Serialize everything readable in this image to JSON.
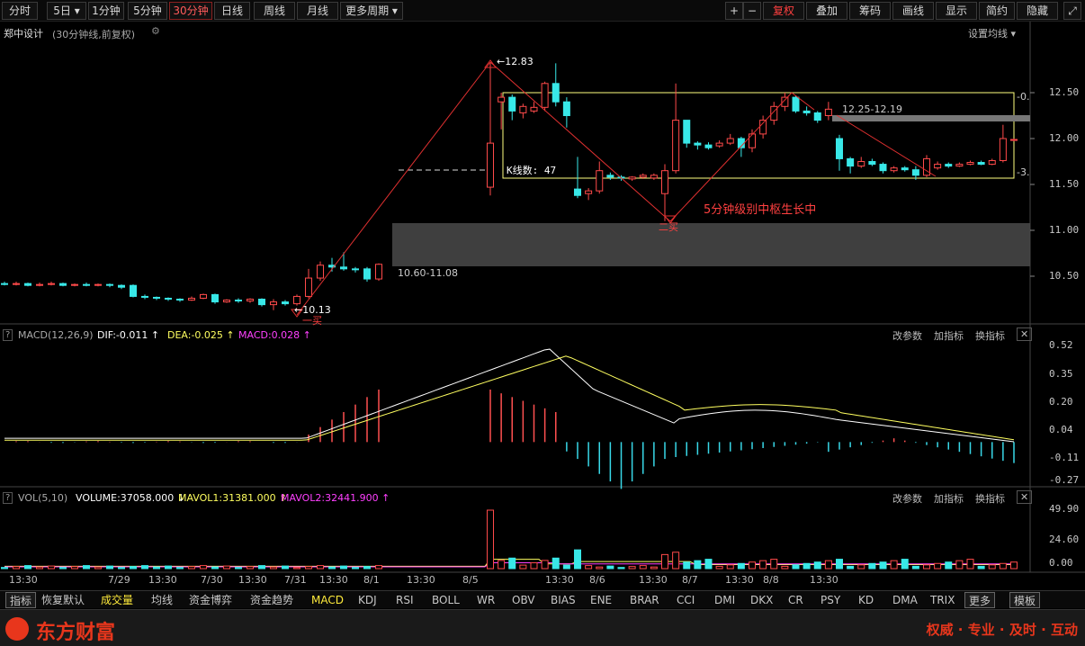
{
  "toolbar": {
    "left": [
      "分时",
      "5日",
      "1分钟",
      "5分钟",
      "30分钟",
      "日线",
      "周线",
      "月线",
      "更多周期"
    ],
    "right": [
      "+",
      "−",
      "复权",
      "叠加",
      "筹码",
      "画线",
      "显示",
      "简约",
      "隐藏"
    ],
    "five_day_arrow": "▾",
    "more_arrow": "▾"
  },
  "stock": {
    "name": "郑中设计",
    "desc": "(30分钟线,前复权)",
    "ma_setting": "设置均线"
  },
  "price_scale": [
    "12.50",
    "12.00",
    "11.50",
    "11.00",
    "10.50"
  ],
  "annotations": {
    "high": "←12.83",
    "low": "←10.13",
    "low_mark": "一买",
    "mid_low_mark": "二买",
    "zone_upper": "12.25-12.19",
    "zone_lower": "10.60-11.08",
    "kline_count": "K线数: 47",
    "pivot_text": "5分钟级别中枢生长中",
    "right_top_label": "-0.",
    "right_bottom_label": "-3."
  },
  "macd": {
    "title": "MACD(12,26,9)",
    "dif": "DIF:-0.011",
    "dea": "DEA:-0.025",
    "macd": "MACD:0.028",
    "scale": [
      "0.52",
      "0.35",
      "0.20",
      "0.04",
      "-0.11",
      "-0.27"
    ],
    "btns": [
      "改参数",
      "加指标",
      "换指标"
    ]
  },
  "vol": {
    "title": "VOL(5,10)",
    "volume": "VOLUME:37058.000",
    "mavol1": "MAVOL1:31381.000",
    "mavol2": "MAVOL2:32441.900",
    "scale": [
      "49.90",
      "24.60",
      "0.00"
    ],
    "btns": [
      "改参数",
      "加指标",
      "换指标"
    ]
  },
  "time_axis": [
    "13:30",
    "7/29",
    "13:30",
    "7/30",
    "13:30",
    "7/31",
    "13:30",
    "8/1",
    "13:30",
    "8/5",
    "13:30",
    "8/6",
    "13:30",
    "8/7",
    "13:30",
    "8/8",
    "13:30"
  ],
  "tabs": [
    "指标",
    "恢复默认",
    "成交量",
    "均线",
    "资金博弈",
    "资金趋势",
    "MACD",
    "KDJ",
    "RSI",
    "BOLL",
    "WR",
    "OBV",
    "BIAS",
    "ENE",
    "BRAR",
    "CCI",
    "DMI",
    "DKX",
    "CR",
    "PSY",
    "KD",
    "DMA",
    "TRIX",
    "更多",
    "模板"
  ],
  "footer": {
    "logo": "东方财富",
    "slogan": "权威 · 专业 · 及时 · 互动"
  },
  "colors": {
    "up": "#ff4a4a",
    "down": "#38e8e8",
    "dif": "#ffffff",
    "dea": "#ffff60",
    "zone": "#ffff80"
  }
}
